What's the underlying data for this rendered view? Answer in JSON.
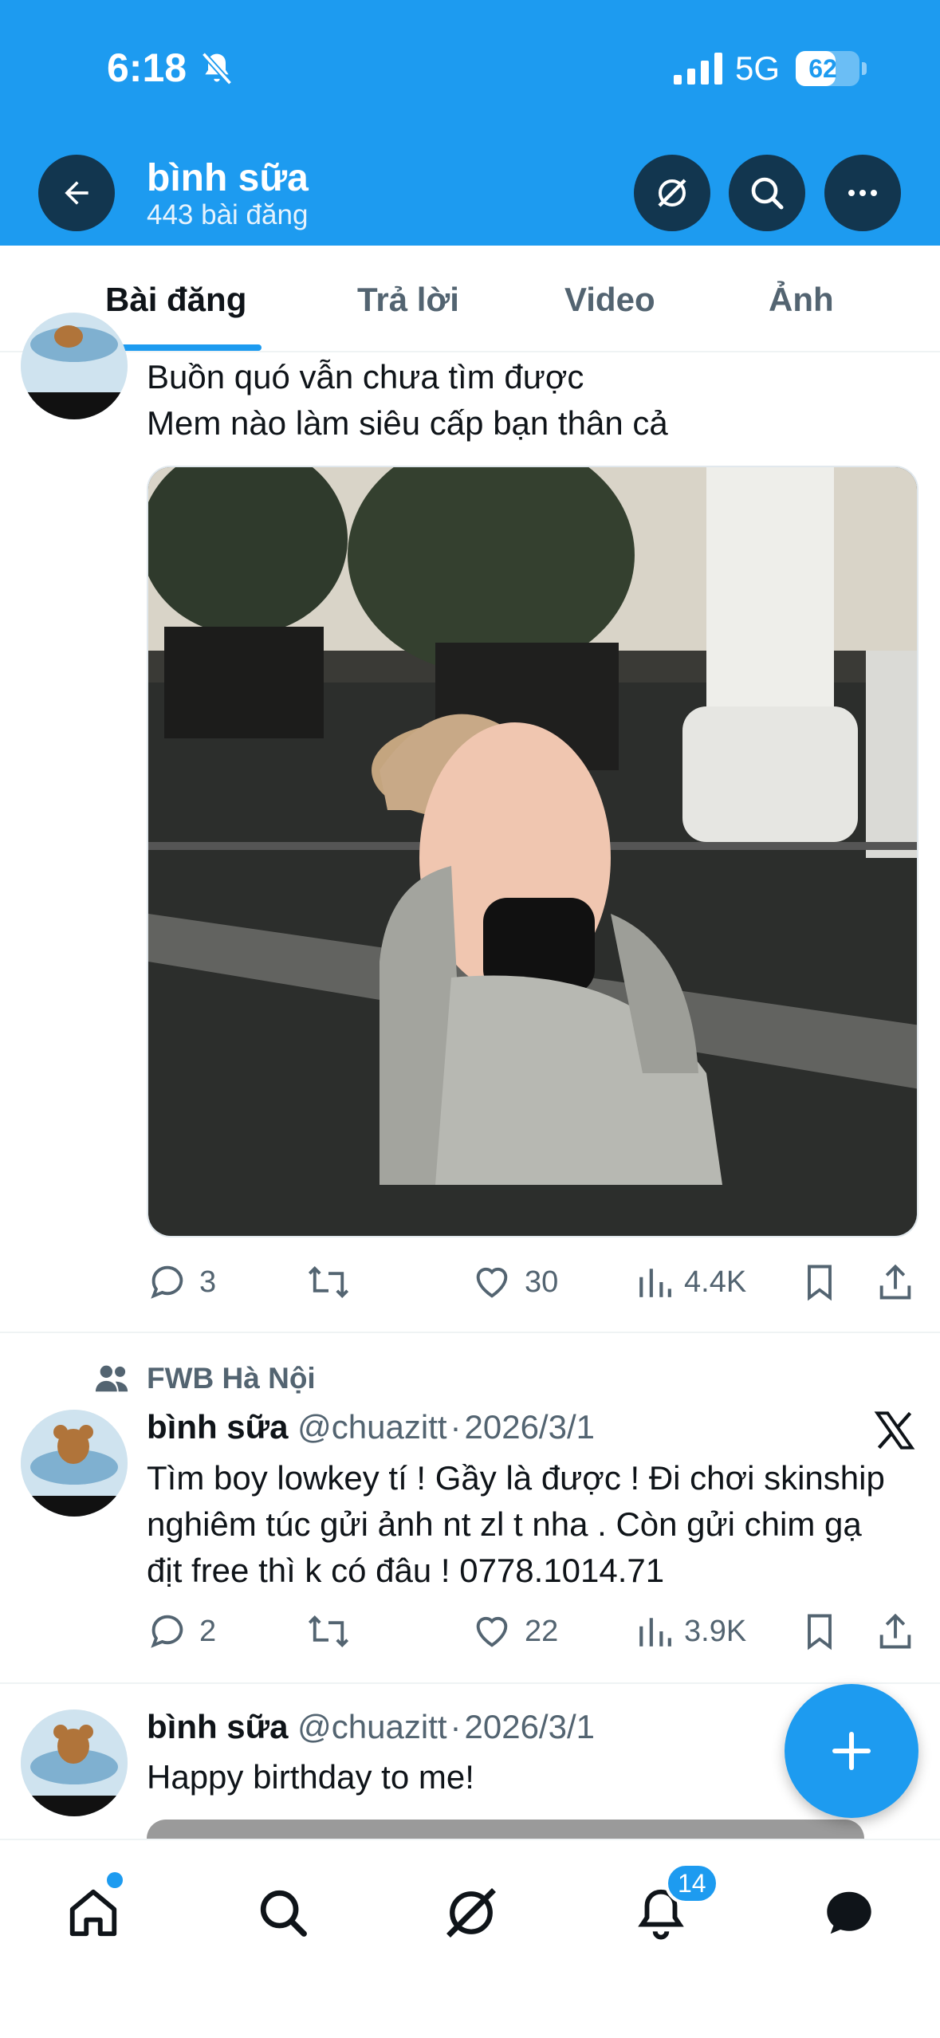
{
  "status_bar": {
    "time": "6:18",
    "network": "5G",
    "battery": "62",
    "battery_level": 0.62
  },
  "header": {
    "name": "bình sữa",
    "post_count": "443 bài đăng",
    "buttons": [
      "back-icon",
      "grok-icon",
      "search-icon",
      "more-icon"
    ]
  },
  "tabs": [
    "Bài đăng",
    "Trả lời",
    "Video",
    "Ảnh"
  ],
  "posts": [
    {
      "lines": [
        "Buồn quó vẫn chưa tìm được",
        "Mem nào làm siêu cấp bạn thân cả"
      ],
      "replies": "3",
      "likes": "30",
      "views": "4.4K"
    },
    {
      "community": "FWB Hà Nội",
      "name": "bình sữa",
      "handle": "@chuazitt",
      "date": "2026/3/1",
      "lines": [
        "Tìm boy lowkey tí ! Gầy là được ! Đi chơi skinship",
        "nghiêm túc gửi ảnh nt zl t nha . Còn gửi chim gạ",
        "địt free thì k có đâu ! 0778.1014.71"
      ],
      "replies": "2",
      "likes": "22",
      "views": "3.9K"
    },
    {
      "name": "bình sữa",
      "handle": "@chuazitt",
      "date": "2026/3/1",
      "lines": [
        "Happy birthday to me!"
      ]
    }
  ],
  "separator": "·",
  "bottom_nav": {
    "items": [
      "home-icon",
      "search-icon",
      "grok-icon",
      "notifications-icon",
      "messages-icon"
    ],
    "notification_count": "14"
  },
  "colors": {
    "accent": "#1d9bf0",
    "text": "#0f1419",
    "muted": "#536471"
  }
}
